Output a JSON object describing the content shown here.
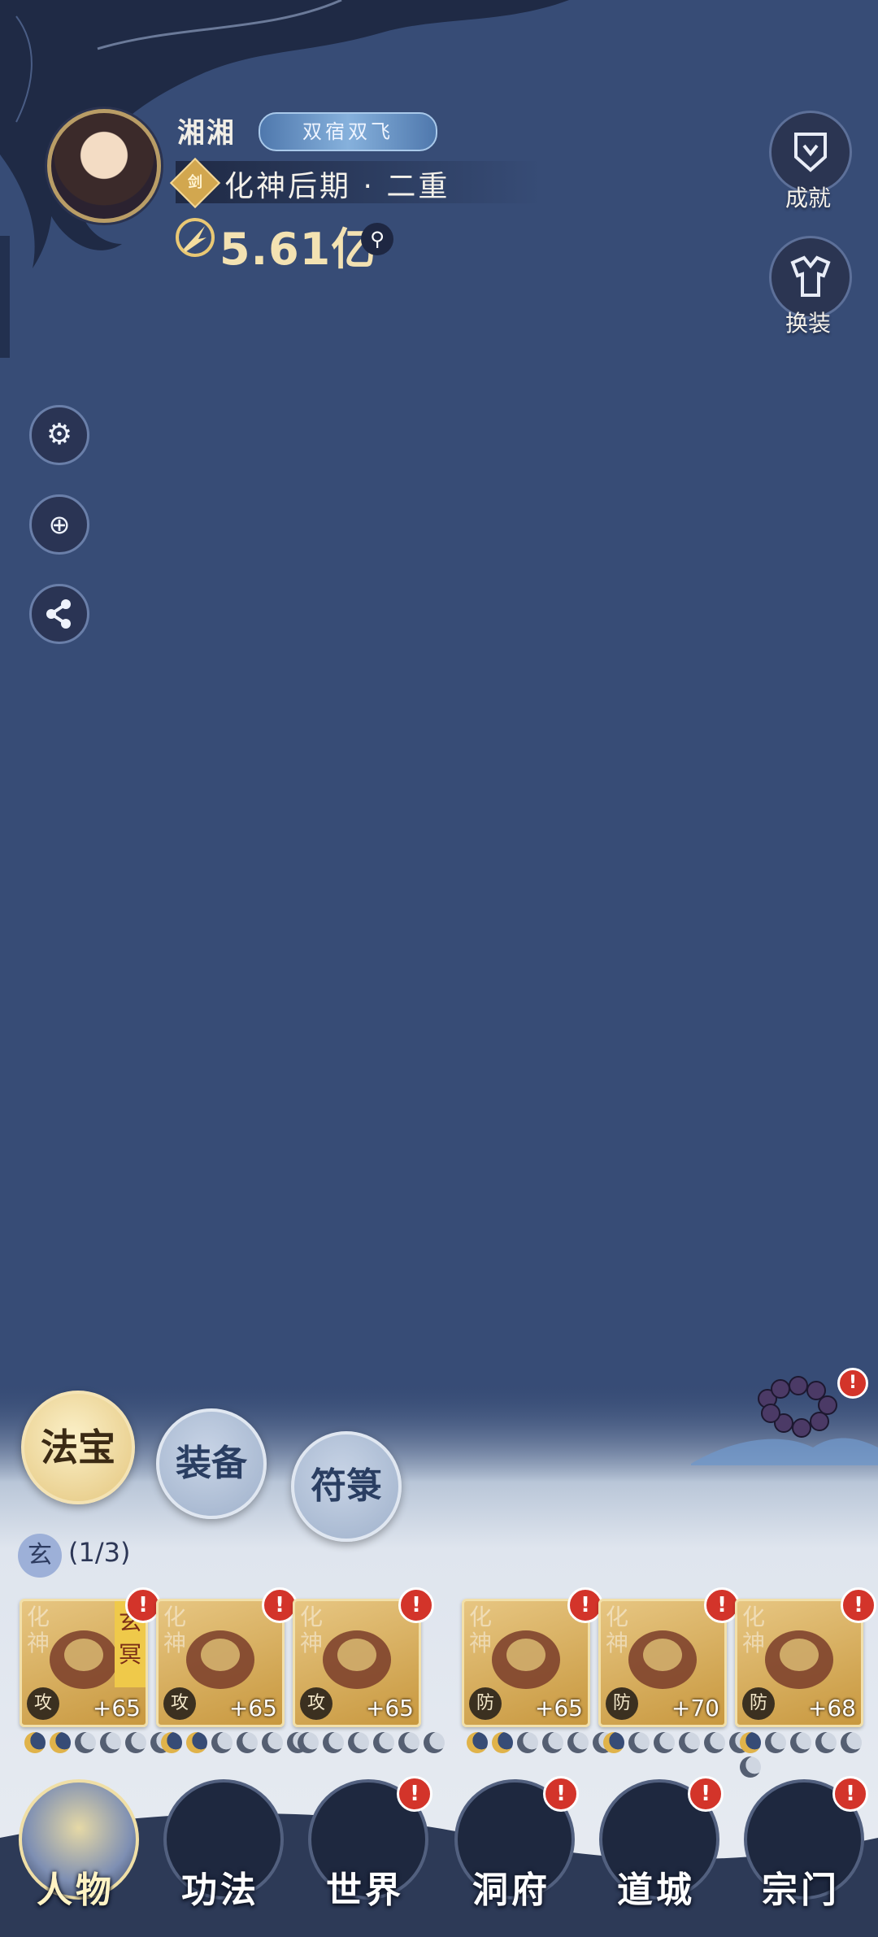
{
  "profile": {
    "name": "湘湘",
    "title_badge": "双宿双飞",
    "realm_tag": "剑",
    "realm": "化神后期 · 二重",
    "power": "5.61亿"
  },
  "right_buttons": [
    {
      "label": "成就",
      "icon": "achievement-shield-icon"
    },
    {
      "label": "换装",
      "icon": "outfit-icon"
    }
  ],
  "side_buttons": [
    "gear-icon",
    "zoom-view-icon",
    "share-icon"
  ],
  "category_tabs": [
    {
      "label": "法宝",
      "active": true
    },
    {
      "label": "装备",
      "active": false
    },
    {
      "label": "符箓",
      "active": false
    }
  ],
  "tier": {
    "badge": "玄",
    "progress": "(1/3)"
  },
  "slots": [
    {
      "bg": "化神",
      "type": "攻",
      "level": "+65",
      "tag": "玄冥",
      "alert": "!",
      "stars_on": 2,
      "stars_total": 6
    },
    {
      "bg": "化神",
      "type": "攻",
      "level": "+65",
      "tag": "",
      "alert": "!",
      "stars_on": 2,
      "stars_total": 6
    },
    {
      "bg": "化神",
      "type": "攻",
      "level": "+65",
      "tag": "",
      "alert": "!",
      "stars_on": 0,
      "stars_total": 6
    },
    {
      "bg": "化神",
      "type": "防",
      "level": "+65",
      "tag": "",
      "alert": "!",
      "stars_on": 2,
      "stars_total": 6
    },
    {
      "bg": "化神",
      "type": "防",
      "level": "+70",
      "tag": "",
      "alert": "!",
      "stars_on": 1,
      "stars_total": 6
    },
    {
      "bg": "化神",
      "type": "防",
      "level": "+68",
      "tag": "",
      "alert": "!",
      "stars_on": 1,
      "stars_total": 6
    }
  ],
  "bracelet_alert": "!",
  "nav": [
    {
      "label": "人物",
      "alert": false,
      "active": true
    },
    {
      "label": "功法",
      "alert": false,
      "active": false
    },
    {
      "label": "世界",
      "alert": true,
      "active": false
    },
    {
      "label": "洞府",
      "alert": true,
      "active": false
    },
    {
      "label": "道城",
      "alert": true,
      "active": false
    },
    {
      "label": "宗门",
      "alert": true,
      "active": false
    }
  ],
  "colors": {
    "background": "#374c76",
    "gold": "#e0b34a",
    "alert": "#d3342a"
  }
}
